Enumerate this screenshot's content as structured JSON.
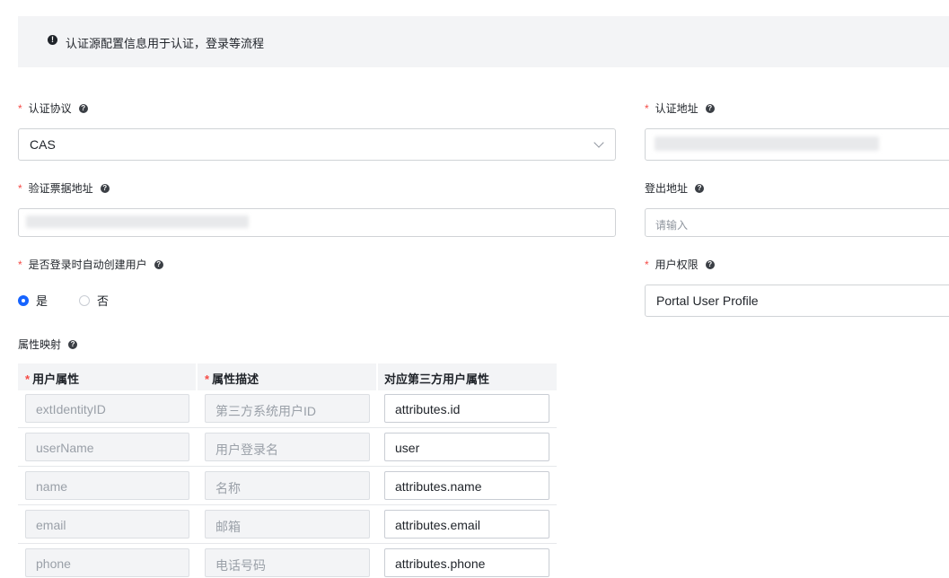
{
  "banner": {
    "icon": "exclamation-circle-icon",
    "text": "认证源配置信息用于认证，登录等流程"
  },
  "required_mark": "*",
  "fields": {
    "auth_protocol": {
      "label": "认证协议",
      "value": "CAS"
    },
    "auth_address": {
      "label": "认证地址"
    },
    "ticket_validation_address": {
      "label": "验证票据地址"
    },
    "logout_address": {
      "label": "登出地址",
      "placeholder": "请输入"
    },
    "auto_create_user": {
      "label": "是否登录时自动创建用户",
      "options": [
        "是",
        "否"
      ],
      "selected": "是"
    },
    "user_permission": {
      "label": "用户权限",
      "value": "Portal User Profile"
    }
  },
  "attribute_mapping": {
    "label": "属性映射",
    "columns": [
      "用户属性",
      "属性描述",
      "对应第三方用户属性"
    ],
    "rows": [
      {
        "attr": "extIdentityID",
        "desc": "第三方系统用户ID",
        "mapped": "attributes.id"
      },
      {
        "attr": "userName",
        "desc": "用户登录名",
        "mapped": "user"
      },
      {
        "attr": "name",
        "desc": "名称",
        "mapped": "attributes.name"
      },
      {
        "attr": "email",
        "desc": "邮箱",
        "mapped": "attributes.email"
      },
      {
        "attr": "phone",
        "desc": "电话号码",
        "mapped": "attributes.phone"
      }
    ]
  },
  "colors": {
    "required": "#f54a45",
    "primary": "#1664ff"
  }
}
